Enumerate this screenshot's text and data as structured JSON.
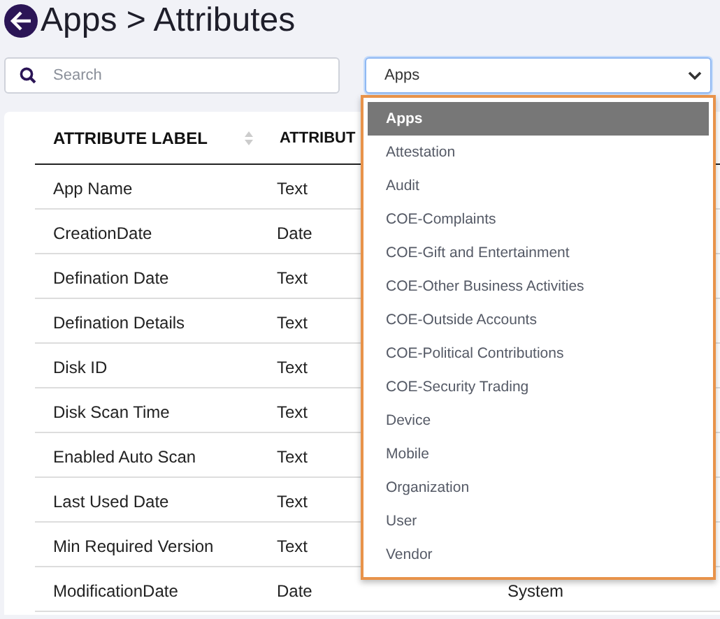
{
  "header": {
    "title": "Apps > Attributes"
  },
  "search": {
    "placeholder": "Search"
  },
  "select": {
    "value": "Apps",
    "open": true,
    "options": [
      {
        "label": "Apps",
        "selected": true
      },
      {
        "label": "Attestation",
        "selected": false
      },
      {
        "label": "Audit",
        "selected": false
      },
      {
        "label": "COE-Complaints",
        "selected": false
      },
      {
        "label": "COE-Gift and Entertainment",
        "selected": false
      },
      {
        "label": "COE-Other Business Activities",
        "selected": false
      },
      {
        "label": "COE-Outside Accounts",
        "selected": false
      },
      {
        "label": "COE-Political Contributions",
        "selected": false
      },
      {
        "label": "COE-Security Trading",
        "selected": false
      },
      {
        "label": "Device",
        "selected": false
      },
      {
        "label": "Mobile",
        "selected": false
      },
      {
        "label": "Organization",
        "selected": false
      },
      {
        "label": "User",
        "selected": false
      },
      {
        "label": "Vendor",
        "selected": false
      }
    ]
  },
  "table": {
    "columns": [
      "ATTRIBUTE LABEL",
      "ATTRIBUT"
    ],
    "rows": [
      {
        "label": "App Name",
        "type": "Text"
      },
      {
        "label": "CreationDate",
        "type": "Date"
      },
      {
        "label": "Defination Date",
        "type": "Text"
      },
      {
        "label": "Defination Details",
        "type": "Text"
      },
      {
        "label": "Disk ID",
        "type": "Text"
      },
      {
        "label": "Disk Scan Time",
        "type": "Text"
      },
      {
        "label": "Enabled Auto Scan",
        "type": "Text"
      },
      {
        "label": "Last Used Date",
        "type": "Text"
      },
      {
        "label": "Min Required Version",
        "type": "Text"
      },
      {
        "label": "ModificationDate",
        "type": "Date",
        "column_3": "System"
      }
    ]
  }
}
